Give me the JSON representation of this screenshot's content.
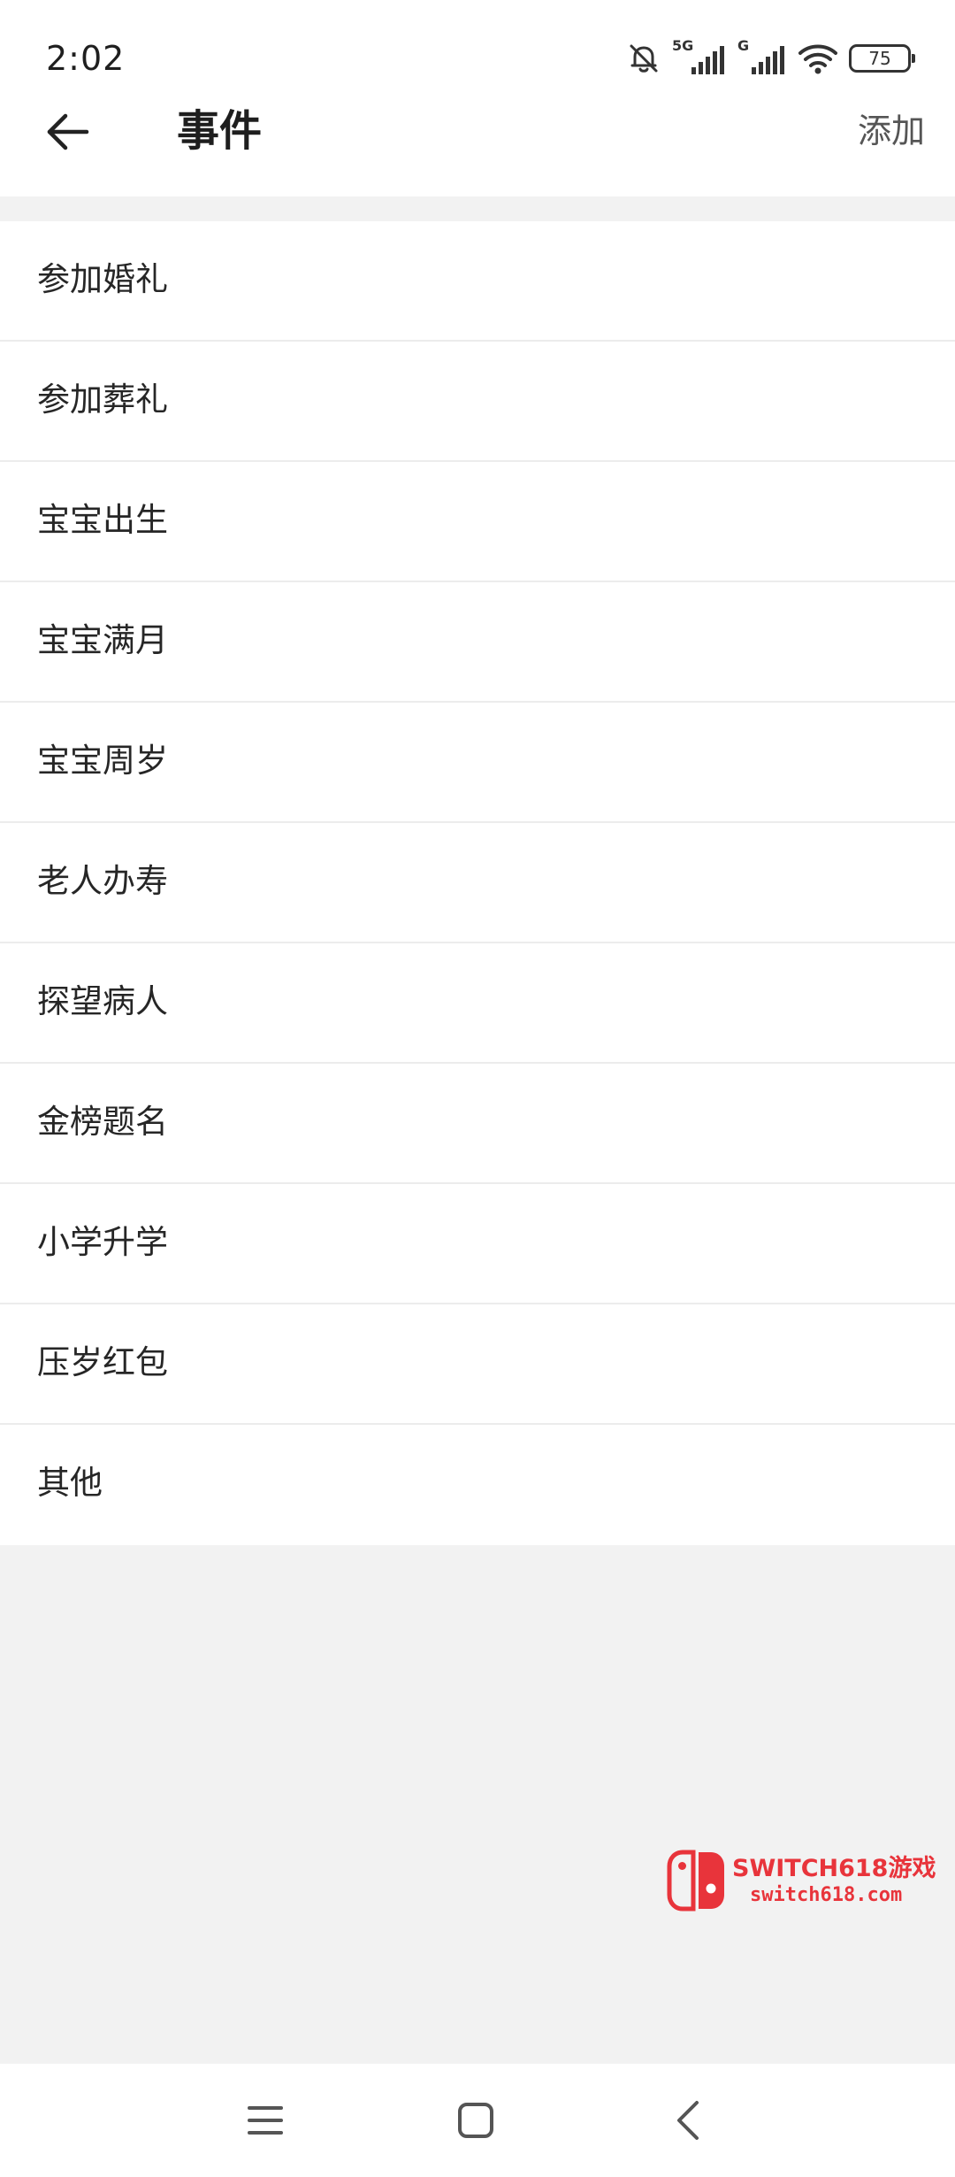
{
  "status_bar": {
    "time": "2:02",
    "network_5g": "5G",
    "network_g": "G",
    "battery": "75"
  },
  "header": {
    "title": "事件",
    "add_label": "添加"
  },
  "events": [
    "参加婚礼",
    "参加葬礼",
    "宝宝出生",
    "宝宝满月",
    "宝宝周岁",
    "老人办寿",
    "探望病人",
    "金榜题名",
    "小学升学",
    "压岁红包",
    "其他"
  ],
  "watermark": {
    "line1": "SWITCH618游戏",
    "line2": "switch618.com",
    "color": "#e8343b"
  },
  "icons": {
    "mute": "bell-off-icon",
    "signal": "signal-bars-icon",
    "wifi": "wifi-icon",
    "back": "arrow-left-icon",
    "nav_menu": "menu-icon",
    "nav_home": "square-icon",
    "nav_back": "chevron-left-icon"
  }
}
